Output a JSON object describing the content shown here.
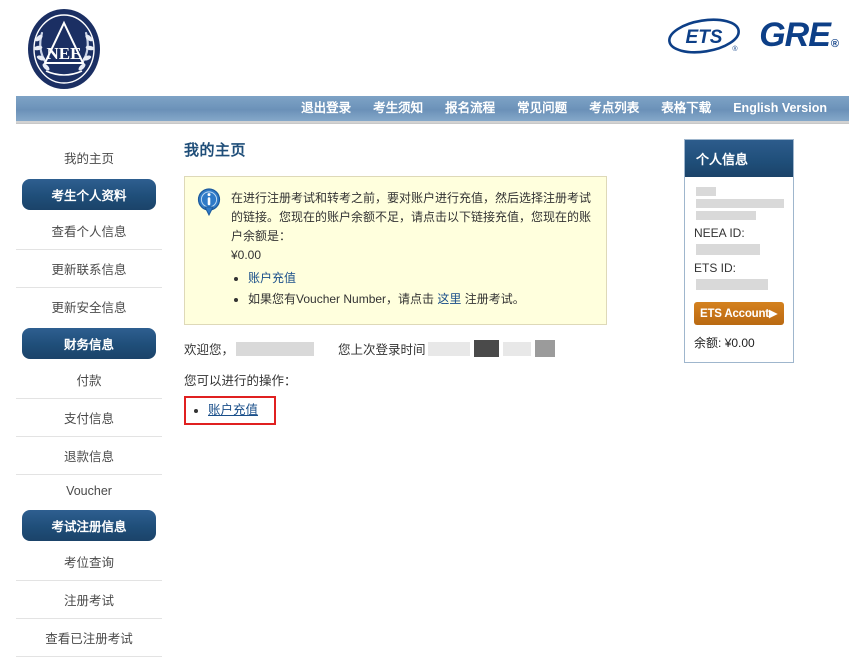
{
  "header": {
    "neea_logo_alt": "NEEA seal logo",
    "neea_logo_text": "NEE",
    "ets_logo_text": "ETS",
    "gre_logo_text": "GRE",
    "gre_registered_mark": "®"
  },
  "nav": {
    "items": [
      {
        "label": "退出登录",
        "name": "nav-logout"
      },
      {
        "label": "考生须知",
        "name": "nav-test-taker-notice"
      },
      {
        "label": "报名流程",
        "name": "nav-registration-process"
      },
      {
        "label": "常见问题",
        "name": "nav-faq"
      },
      {
        "label": "考点列表",
        "name": "nav-test-center-list"
      },
      {
        "label": "表格下载",
        "name": "nav-form-download"
      },
      {
        "label": "English Version",
        "name": "nav-english-version"
      }
    ]
  },
  "sidebar": {
    "items": [
      {
        "label": "我的主页",
        "type": "link",
        "name": "sidebar-item-my-homepage"
      },
      {
        "label": "考生个人资料",
        "type": "head",
        "name": "sidebar-section-personal-profile"
      },
      {
        "label": "查看个人信息",
        "type": "link",
        "name": "sidebar-item-view-personal-info"
      },
      {
        "label": "更新联系信息",
        "type": "link",
        "name": "sidebar-item-update-contact-info"
      },
      {
        "label": "更新安全信息",
        "type": "link",
        "name": "sidebar-item-update-security-info"
      },
      {
        "label": "财务信息",
        "type": "head",
        "name": "sidebar-section-financial-info"
      },
      {
        "label": "付款",
        "type": "link",
        "name": "sidebar-item-payment"
      },
      {
        "label": "支付信息",
        "type": "link",
        "name": "sidebar-item-payment-info"
      },
      {
        "label": "退款信息",
        "type": "link",
        "name": "sidebar-item-refund-info"
      },
      {
        "label": "Voucher",
        "type": "link",
        "name": "sidebar-item-voucher"
      },
      {
        "label": "考试注册信息",
        "type": "head",
        "name": "sidebar-section-test-registration-info"
      },
      {
        "label": "考位查询",
        "type": "link",
        "name": "sidebar-item-seat-search"
      },
      {
        "label": "注册考试",
        "type": "link",
        "name": "sidebar-item-register-test"
      },
      {
        "label": "查看已注册考试",
        "type": "link",
        "name": "sidebar-item-view-registered-tests"
      }
    ]
  },
  "main": {
    "title": "我的主页",
    "info_box": {
      "icon": "info-bubble-icon",
      "paragraph": "在进行注册考试和转考之前，要对账户进行充值，然后选择注册考试的链接。您现在的账户余额不足，请点击以下链接充值，您现在的账户余额是：",
      "balance": "¥0.00",
      "bullet1": "账户充值",
      "bullet2_before": "如果您有Voucher Number，请点击 ",
      "bullet2_link": "这里",
      "bullet2_after": " 注册考试。"
    },
    "welcome": {
      "greeting": "欢迎您，",
      "last_login_label": "您上次登录时间"
    },
    "actions": {
      "label": "您可以进行的操作：",
      "items": [
        {
          "label": "账户充值",
          "name": "action-account-recharge"
        }
      ]
    }
  },
  "right_panel": {
    "title": "个人信息",
    "neea_id_label": "NEEA ID:",
    "ets_id_label": "ETS ID:",
    "ets_account_button": "ETS Account▶",
    "balance_label": "余额:",
    "balance_value": "¥0.00"
  },
  "colors": {
    "nav_blue": "#6f95bb",
    "panel_navy": "#1f4e79",
    "info_bg": "#ffffdd",
    "info_border": "#ded9b8",
    "orange_button": "#c67317",
    "highlight_red": "#e02020",
    "link_blue": "#1a4f8a"
  }
}
